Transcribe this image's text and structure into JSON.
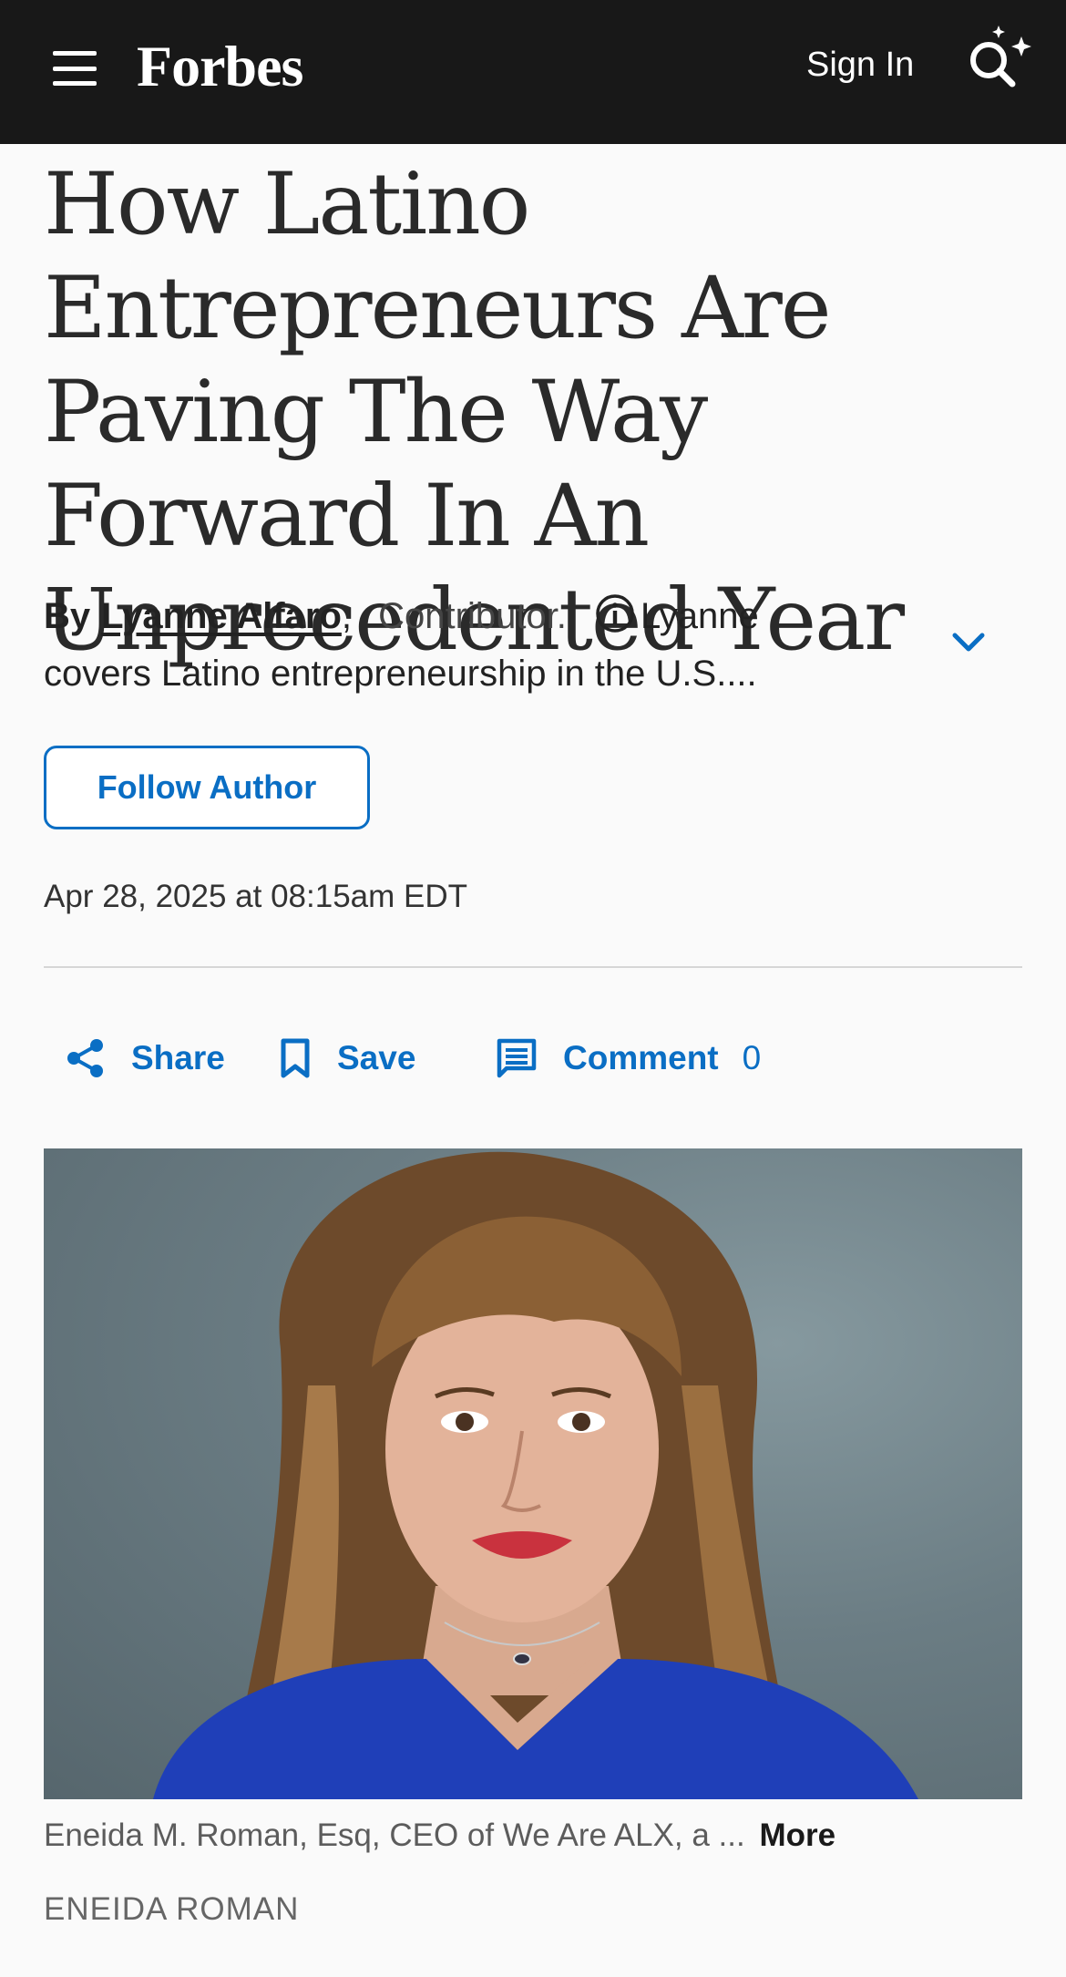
{
  "header": {
    "logo": "Forbes",
    "sign_in_label": "Sign In",
    "search_icon": "search-sparkle-icon",
    "menu_icon": "hamburger-menu-icon"
  },
  "article": {
    "headline": "How Latino Entrepreneurs Are Paving The Way Forward In An Unprecedented Year",
    "byline": {
      "by": "By",
      "author_name": "Lyanne Alfaro",
      "separator": ",",
      "role": "Contributor.",
      "bio_preview": "Lyanne covers Latino entrepreneurship in the U.S...."
    },
    "follow_label": "Follow Author",
    "date": "Apr 28, 2025 at 08:15am EDT"
  },
  "actions": {
    "share_label": "Share",
    "save_label": "Save",
    "comment_label": "Comment",
    "comment_count": "0"
  },
  "hero": {
    "caption": "Eneida M. Roman, Esq, CEO of We Are ALX, a ...",
    "more_label": "More",
    "credit": "ENEIDA ROMAN"
  },
  "colors": {
    "header_bg": "#181818",
    "accent": "#0a6ec4",
    "page_bg": "#fafafa"
  }
}
